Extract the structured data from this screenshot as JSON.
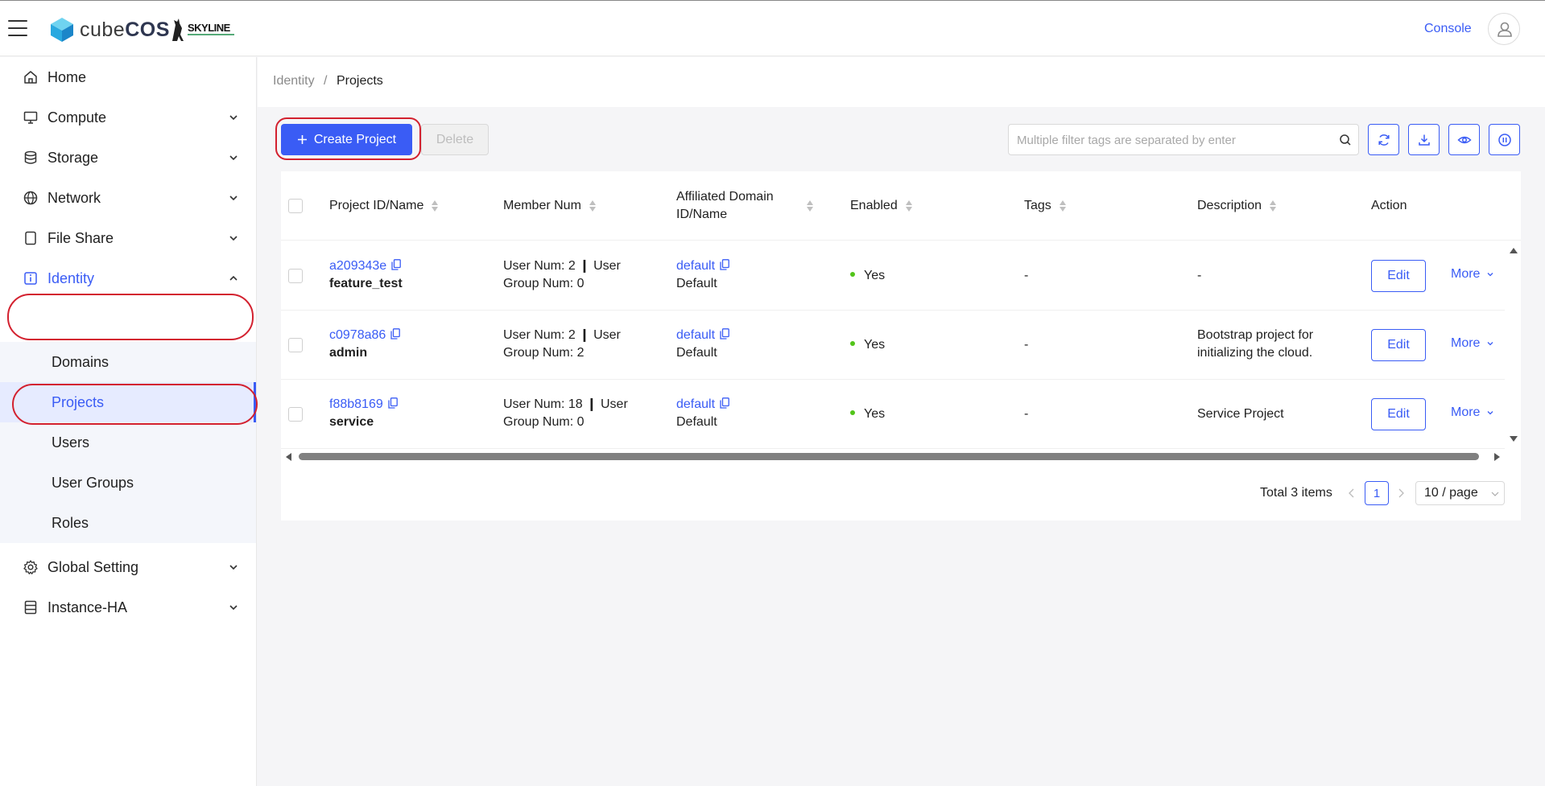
{
  "header": {
    "brand_light": "cube",
    "brand_bold": "COS",
    "partner": "SKYLINE",
    "console_label": "Console"
  },
  "sidebar": {
    "items": [
      {
        "label": "Home",
        "icon": "home-icon"
      },
      {
        "label": "Compute",
        "icon": "monitor-icon"
      },
      {
        "label": "Storage",
        "icon": "database-icon"
      },
      {
        "label": "Network",
        "icon": "globe-icon"
      },
      {
        "label": "File Share",
        "icon": "file-icon"
      },
      {
        "label": "Identity",
        "icon": "info-icon"
      }
    ],
    "identity_sub": [
      "Domains",
      "Projects",
      "Users",
      "User Groups",
      "Roles"
    ],
    "bottom_items": [
      {
        "label": "Global Setting",
        "icon": "gear-icon"
      },
      {
        "label": "Instance-HA",
        "icon": "server-icon"
      }
    ]
  },
  "breadcrumb": {
    "parent": "Identity",
    "separator": "/",
    "current": "Projects"
  },
  "toolbar": {
    "create_label": "Create Project",
    "delete_label": "Delete",
    "search_placeholder": "Multiple filter tags are separated by enter"
  },
  "table": {
    "columns": {
      "id_name": "Project ID/Name",
      "member": "Member Num",
      "domain_l1": "Affiliated Domain",
      "domain_l2": "ID/Name",
      "enabled": "Enabled",
      "tags": "Tags",
      "description": "Description",
      "action": "Action"
    },
    "rows": [
      {
        "id": "a209343e",
        "name": "feature_test",
        "member_l1": "User Num: 2 ❙ User",
        "member_l2": "Group Num: 0",
        "domain_id": "default",
        "domain_name": "Default",
        "enabled": "Yes",
        "tags": "-",
        "desc_l1": "-",
        "desc_l2": "",
        "edit": "Edit",
        "more": "More"
      },
      {
        "id": "c0978a86",
        "name": "admin",
        "member_l1": "User Num: 2 ❙ User",
        "member_l2": "Group Num: 2",
        "domain_id": "default",
        "domain_name": "Default",
        "enabled": "Yes",
        "tags": "-",
        "desc_l1": "Bootstrap project for",
        "desc_l2": "initializing the cloud.",
        "edit": "Edit",
        "more": "More"
      },
      {
        "id": "f88b8169",
        "name": "service",
        "member_l1": "User Num: 18 ❙ User",
        "member_l2": "Group Num: 0",
        "domain_id": "default",
        "domain_name": "Default",
        "enabled": "Yes",
        "tags": "-",
        "desc_l1": "Service Project",
        "desc_l2": "",
        "edit": "Edit",
        "more": "More"
      }
    ]
  },
  "pagination": {
    "total": "Total 3 items",
    "current_page": "1",
    "page_size": "10 / page"
  },
  "colors": {
    "accent": "#3a5cf5",
    "annotation": "#d3212f",
    "status_ok": "#52c41a"
  }
}
